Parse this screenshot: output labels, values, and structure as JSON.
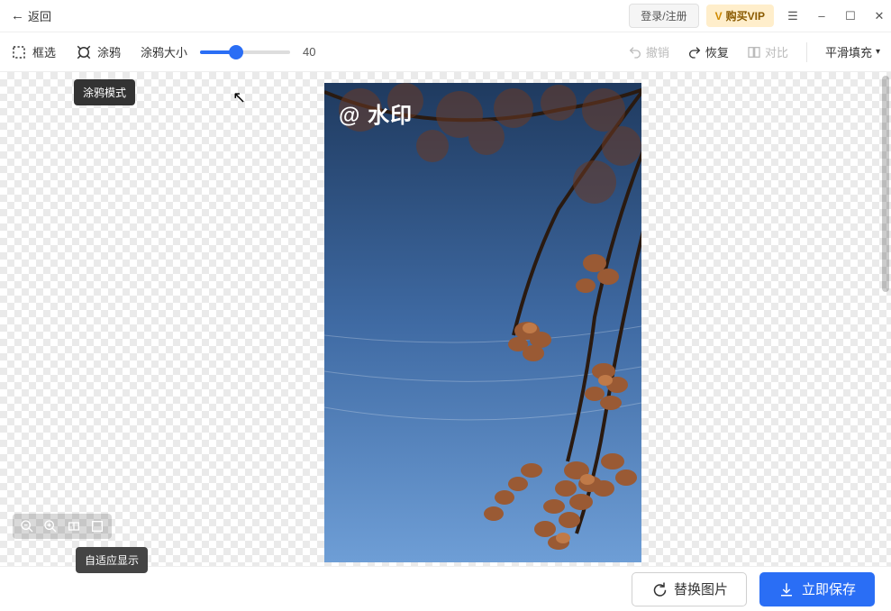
{
  "header": {
    "back_label": "返回",
    "login_label": "登录/注册",
    "vip_label": "购买VIP"
  },
  "toolbar": {
    "box_select_label": "框选",
    "brush_label": "涂鸦",
    "brush_size_label": "涂鸦大小",
    "brush_size_value": "40",
    "undo_label": "撤销",
    "redo_label": "恢复",
    "compare_label": "对比",
    "fill_mode_label": "平滑填充"
  },
  "canvas": {
    "brush_tooltip": "涂鸦模式",
    "zoom_tooltip": "自适应显示",
    "watermark_text": "@ 水印"
  },
  "footer": {
    "replace_label": "替换图片",
    "save_label": "立即保存"
  }
}
